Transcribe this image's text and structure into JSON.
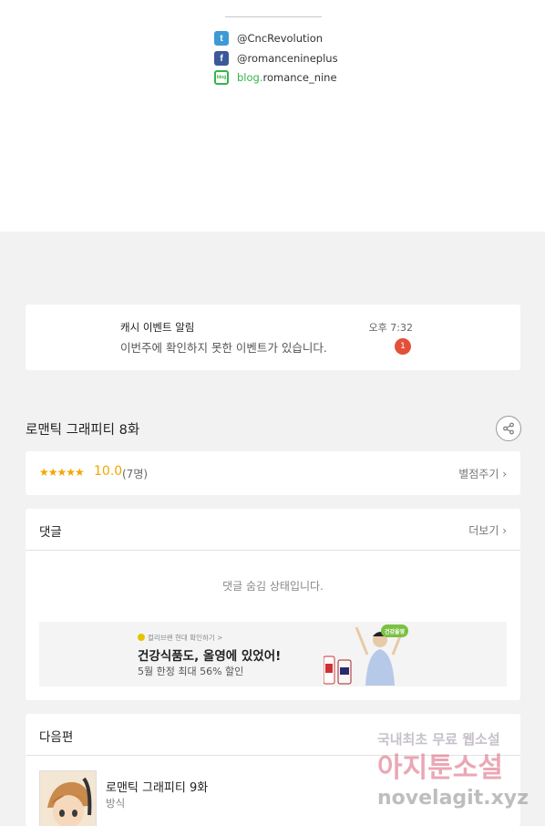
{
  "social": {
    "twitter": "@CncRevolution",
    "facebook": "@romancenineplus",
    "blog_prefix": "blog.",
    "blog_name": "romance_nine"
  },
  "notice": {
    "title": "캐시 이벤트 알림",
    "time": "오후 7:32",
    "message": "이번주에 확인하지 못한 이벤트가 있습니다.",
    "badge": "1"
  },
  "episode": {
    "title": "로맨틱 그래피티 8화"
  },
  "rating": {
    "stars": "★★★★★",
    "score": "10.0",
    "count": "(7명)",
    "rate_link": "별점주기 ›"
  },
  "comments": {
    "label": "댓글",
    "more": "더보기 ›",
    "hidden_message": "댓글 숨김 상태입니다."
  },
  "ad": {
    "small": "컬리브랜 현대 확인하기 >",
    "headline": "건강식품도, 올영에 있었어!",
    "sub": "5월 한정 최대 56% 할인",
    "logo": "건강올영"
  },
  "next": {
    "label": "다음편",
    "title": "로맨틱 그래피티 9화",
    "author": "방식"
  },
  "watermark": {
    "line1": "국내최초 무료 웹소설",
    "line2": "아지툰소설",
    "line3": "novelagit.xyz"
  },
  "colors": {
    "accent_star": "#f2a600",
    "badge": "#e3503a",
    "twitter": "#3d9ad6",
    "facebook": "#3b5998",
    "blog": "#37b34a"
  }
}
